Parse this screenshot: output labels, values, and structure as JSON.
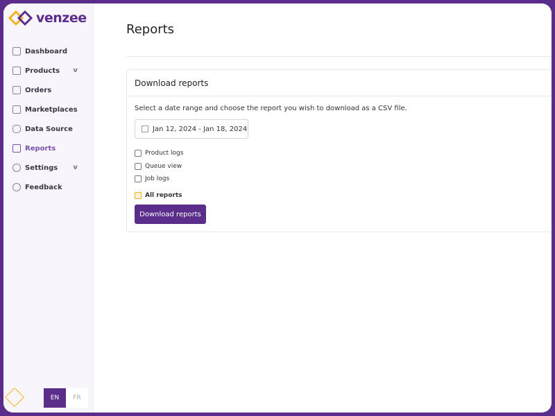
{
  "brand": {
    "name": "venzee",
    "accent": "#5b2d8a",
    "secondary": "#f5b120"
  },
  "sidebar": {
    "items": [
      {
        "label": "Dashboard",
        "icon": "grid-icon"
      },
      {
        "label": "Products",
        "icon": "box-icon",
        "expandable": true
      },
      {
        "label": "Orders",
        "icon": "tray-icon"
      },
      {
        "label": "Marketplaces",
        "icon": "store-icon"
      },
      {
        "label": "Data Source",
        "icon": "database-icon"
      },
      {
        "label": "Reports",
        "icon": "clipboard-icon",
        "active": true
      },
      {
        "label": "Settings",
        "icon": "gear-icon",
        "expandable": true
      },
      {
        "label": "Feedback",
        "icon": "chat-icon"
      }
    ],
    "lang": {
      "en": "EN",
      "fr": "FR",
      "selected": "EN"
    }
  },
  "page": {
    "title": "Reports"
  },
  "card": {
    "title": "Download reports",
    "description": "Select a date range and choose the report you wish to download as a CSV file.",
    "date_range": "Jan 12, 2024 - Jan 18, 2024",
    "options": [
      {
        "label": "Product logs",
        "checked": false
      },
      {
        "label": "Queue view",
        "checked": false
      },
      {
        "label": "Job logs",
        "checked": false
      },
      {
        "label": "All reports",
        "checked": true
      }
    ],
    "button": "Download reports"
  }
}
